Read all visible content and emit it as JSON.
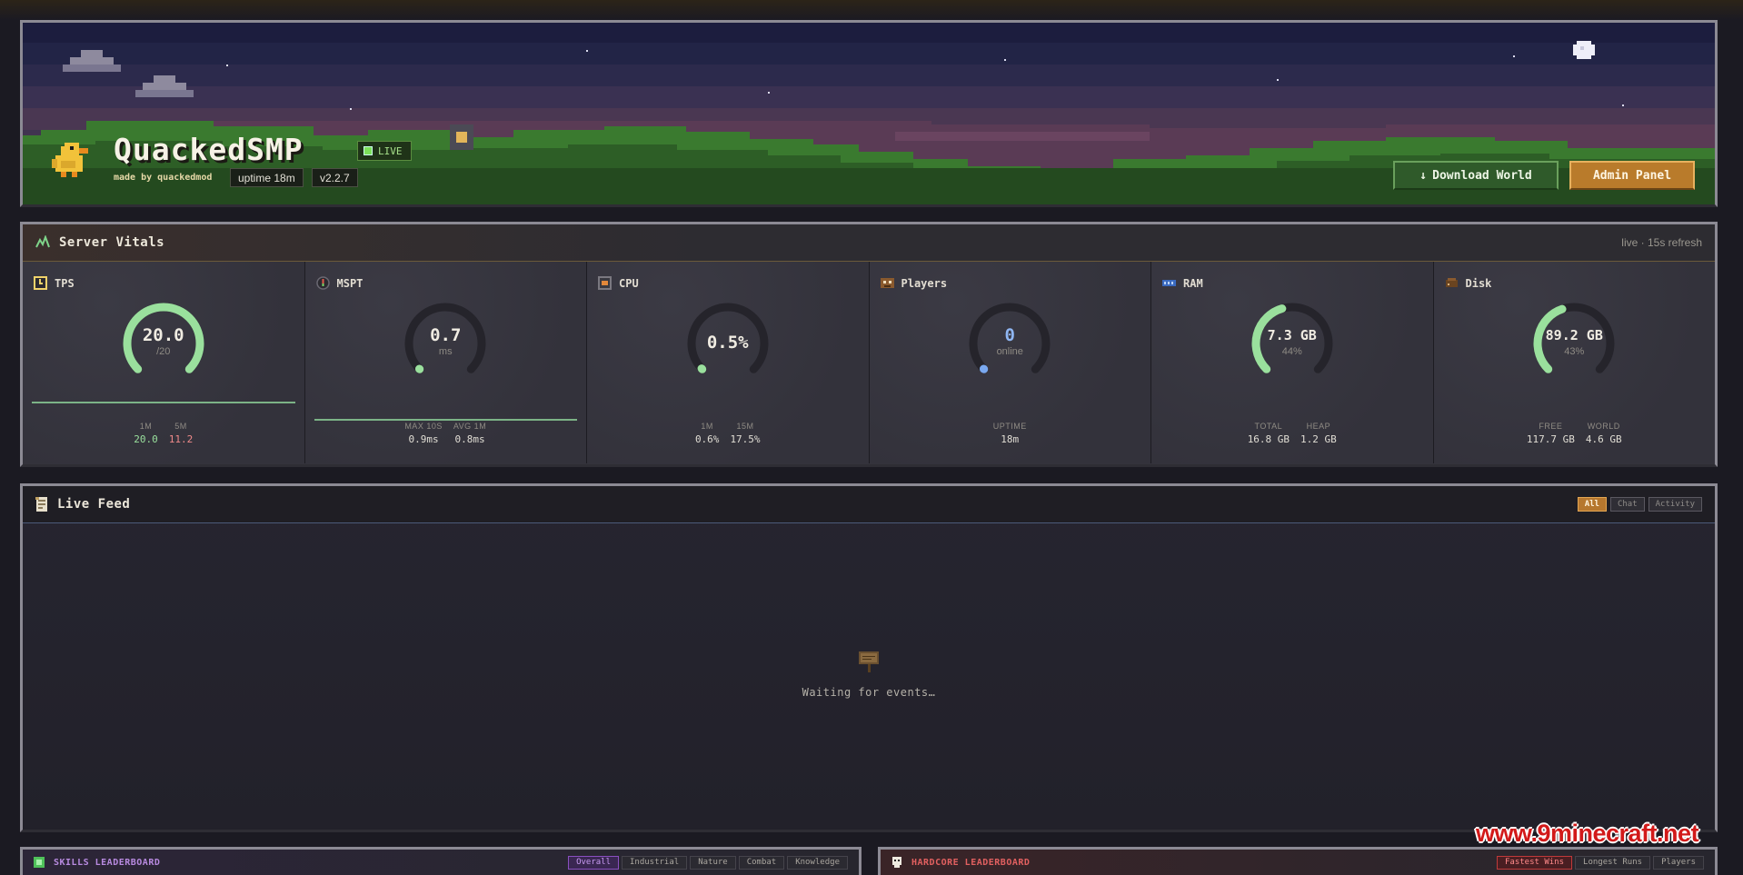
{
  "hero": {
    "server_name": "QuackedSMP",
    "live_label": "LIVE",
    "made_by": "made by quackedmod",
    "uptime_chip": "uptime 18m",
    "version_chip": "v2.2.7",
    "download_label": "Download World",
    "download_icon": "download-arrow-icon",
    "admin_label": "Admin Panel"
  },
  "vitals": {
    "title": "Server Vitals",
    "meta": "live · 15s refresh",
    "cards": [
      {
        "name": "tps",
        "label": "TPS",
        "icon": "clock-icon",
        "value": "20.0",
        "sub": "/20",
        "fraction": 1.0,
        "stats": [
          {
            "label": "1M",
            "value": "20.0"
          },
          {
            "label": "5M",
            "value": "11.2"
          }
        ]
      },
      {
        "name": "mspt",
        "label": "MSPT",
        "icon": "gauge-icon",
        "value": "0.7",
        "sub": "ms",
        "fraction": 0.0,
        "stats": [
          {
            "label": "MAX 10S",
            "value": "0.9ms"
          },
          {
            "label": "AVG 1M",
            "value": "0.8ms"
          }
        ]
      },
      {
        "name": "cpu",
        "label": "CPU",
        "icon": "cpu-icon",
        "value": "0.5%",
        "sub": "",
        "fraction": 0.005,
        "stats": [
          {
            "label": "1M",
            "value": "0.6%"
          },
          {
            "label": "15M",
            "value": "17.5%"
          }
        ]
      },
      {
        "name": "players",
        "label": "Players",
        "icon": "players-icon",
        "value": "0",
        "sub": "online",
        "fraction": 0.0,
        "stats": [
          {
            "label": "UPTIME",
            "value": "18m"
          }
        ]
      },
      {
        "name": "ram",
        "label": "RAM",
        "icon": "ram-icon",
        "value": "7.3 GB",
        "sub": "44%",
        "fraction": 0.44,
        "stats": [
          {
            "label": "TOTAL",
            "value": "16.8 GB"
          },
          {
            "label": "HEAP",
            "value": "1.2 GB"
          }
        ]
      },
      {
        "name": "disk",
        "label": "Disk",
        "icon": "disk-icon",
        "value": "89.2 GB",
        "sub": "43%",
        "fraction": 0.43,
        "stats": [
          {
            "label": "FREE",
            "value": "117.7 GB"
          },
          {
            "label": "WORLD",
            "value": "4.6 GB"
          }
        ]
      }
    ],
    "colors": {
      "good": "#9ae09d",
      "bad": "#f08a8a",
      "players_dot": "#7aa8f0",
      "track": "#2a2930"
    }
  },
  "feed": {
    "title": "Live Feed",
    "filters": [
      "All",
      "Chat",
      "Activity"
    ],
    "active_filter": "All",
    "empty_text": "Waiting for events…"
  },
  "skills_lb": {
    "title": "SKILLS LEADERBOARD",
    "tabs": [
      "Overall",
      "Industrial",
      "Nature",
      "Combat",
      "Knowledge"
    ],
    "active_tab": "Overall"
  },
  "hardcore_lb": {
    "title": "HARDCORE LEADERBOARD",
    "tabs": [
      "Fastest Wins",
      "Longest Runs",
      "Players"
    ],
    "active_tab": "Fastest Wins"
  },
  "watermark": "www.9minecraft.net"
}
